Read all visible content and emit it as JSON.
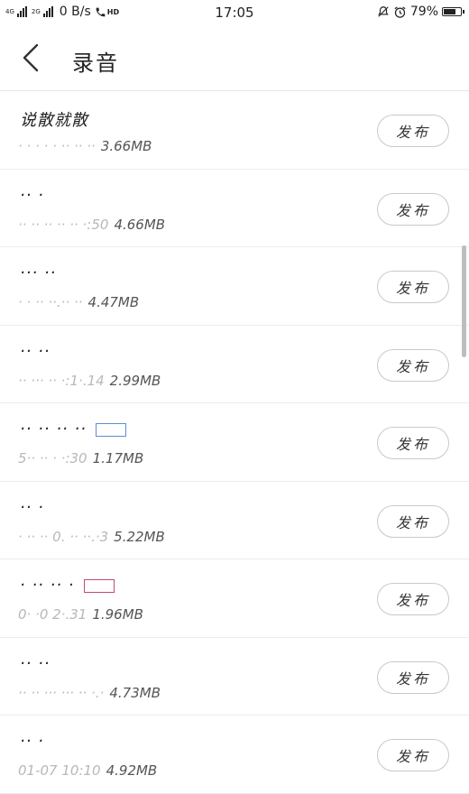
{
  "status_bar": {
    "net_left": "4G",
    "net_left2": "4G",
    "net_right": "2G",
    "speed": "0 B/s",
    "hd": "HD",
    "time": "17:05",
    "battery_text": "79%",
    "battery_level": 0.79
  },
  "header": {
    "title": "录音"
  },
  "recordings": [
    {
      "name": "说散就散",
      "timestamp": "· · · · ·    ·· ·· ··",
      "size": "3.66MB",
      "tag": null,
      "button": "发布"
    },
    {
      "name": "·· ·",
      "timestamp": "·· ·· ·· ·· ·· ·:50",
      "size": "4.66MB",
      "tag": null,
      "button": "发布"
    },
    {
      "name": "··· ··",
      "timestamp": "·       · ·· ··.·· ··",
      "size": "4.47MB",
      "tag": null,
      "button": "发布"
    },
    {
      "name": "·· ··",
      "timestamp": "·· ··· ··  ·:1·.14",
      "size": "2.99MB",
      "tag": null,
      "button": "发布"
    },
    {
      "name": "·· ·· ·· ··",
      "timestamp": "5·· ·· ·   ·:30",
      "size": "1.17MB",
      "tag": "blue",
      "button": "发布"
    },
    {
      "name": "·· ·",
      "timestamp": "· ·· ·· 0. ·· ··.·3",
      "size": "5.22MB",
      "tag": null,
      "button": "发布"
    },
    {
      "name": "· ·· ·· ·",
      "timestamp": "0· ·0 2·.31",
      "size": "1.96MB",
      "tag": "red",
      "button": "发布"
    },
    {
      "name": "·· ··",
      "timestamp": "·· ·· ··· ··· ·· ·.·",
      "size": "4.73MB",
      "tag": null,
      "button": "发布"
    },
    {
      "name": "·· ·",
      "timestamp": "01-07 10:10",
      "size": "4.92MB",
      "tag": null,
      "button": "发布"
    }
  ],
  "colors": {
    "divider": "#ececec",
    "button_border": "#c9c9c9",
    "text": "#222222",
    "meta": "#555555",
    "scrollbar": "#bdbdbd",
    "tag_blue": "#5a8fd6",
    "tag_red": "#c44a6a"
  }
}
